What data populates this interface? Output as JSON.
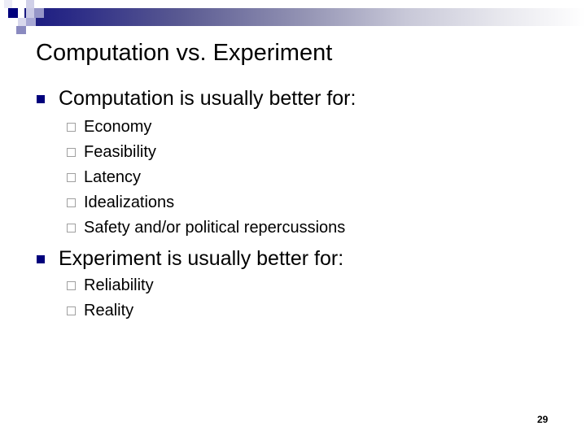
{
  "slide": {
    "title": "Computation vs. Experiment",
    "bullets": [
      {
        "text": "Computation is usually better for:",
        "sub": [
          "Economy",
          "Feasibility",
          "Latency",
          "Idealizations",
          "Safety and/or political repercussions"
        ]
      },
      {
        "text": "Experiment is usually better for:",
        "sub": [
          "Reliability",
          "Reality"
        ]
      }
    ],
    "page_number": "29"
  },
  "theme": {
    "accent": "#00007c",
    "sub_bullet_border": "#a0a0a0"
  }
}
